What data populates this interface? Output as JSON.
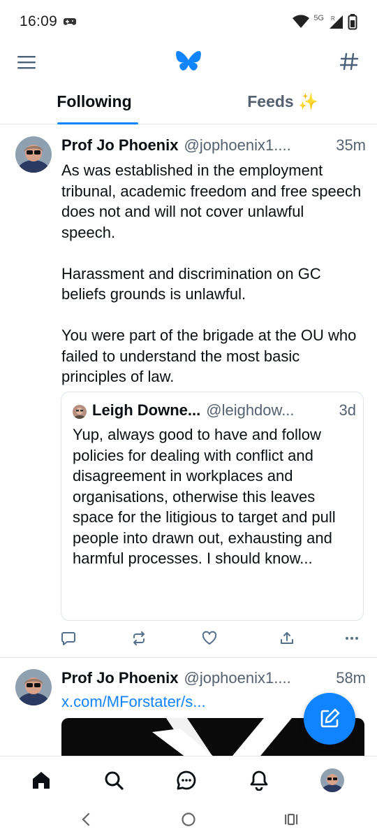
{
  "status_bar": {
    "time": "16:09",
    "network_label": "5G",
    "roaming_label": "R"
  },
  "header": {
    "menu_icon": "hamburger-menu-icon",
    "logo_icon": "bluesky-butterfly-icon",
    "feeds_icon": "hash-icon",
    "accent_color": "#1083fe"
  },
  "tabs": [
    {
      "label": "Following",
      "active": true
    },
    {
      "label": "Feeds ✨",
      "active": false
    }
  ],
  "posts": [
    {
      "author": "Prof Jo Phoenix",
      "handle": "@jophoenix1....",
      "time": "35m",
      "text": "As was established in the employment tribunal, academic freedom and free speech does not and will not cover unlawful speech.\n\nHarassment and discrimination on GC beliefs grounds is unlawful.\n\nYou were part of the brigade at the OU who failed to understand the most basic principles of law.",
      "quote": {
        "author": "Leigh Downe...",
        "handle": "@leighdow...",
        "time": "3d",
        "text": "Yup, always good to have and follow policies for dealing with conflict and disagreement in workplaces and organisations, otherwise this leaves space for the litigious to target and pull people into drawn out, exhausting and harmful processes. I should know..."
      },
      "actions": [
        "reply-icon",
        "repost-icon",
        "like-icon",
        "share-icon",
        "more-icon"
      ]
    },
    {
      "author": "Prof Jo Phoenix",
      "handle": "@jophoenix1....",
      "time": "58m",
      "link": "x.com/MForstater/s..."
    }
  ],
  "fab": {
    "icon": "compose-icon"
  },
  "bottom_nav": [
    "home-icon",
    "search-icon",
    "chat-icon",
    "notifications-icon",
    "profile-avatar"
  ],
  "system_nav": [
    "back-icon",
    "home-circle-icon",
    "recents-icon"
  ]
}
